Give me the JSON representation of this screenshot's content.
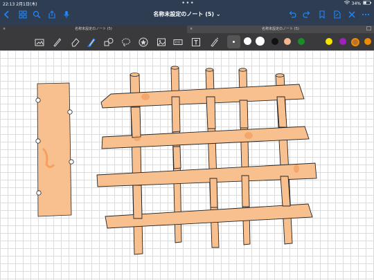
{
  "status": {
    "time": "22:13",
    "date": "2月1日(木)",
    "battery": "34%"
  },
  "header": {
    "title": "名称未設定のノート (5)",
    "title_chevron": "⌄"
  },
  "tabs": [
    {
      "label": "名称未設定のノート (5)",
      "close": "×"
    },
    {
      "label": "名称未設定のノート (5)",
      "close": "×"
    }
  ],
  "colors": {
    "header_bg": "#2e3d52",
    "toolbar_bg": "#3a3a3c",
    "accent": "#1e88ff",
    "sketch_fill": "#f9c08f",
    "sketch_line": "#222222"
  },
  "toolbar": {
    "tools": [
      "image-scan-icon",
      "pen-icon",
      "eraser-icon",
      "highlighter-icon",
      "shapes-icon",
      "lasso-icon",
      "elements-icon",
      "image-icon",
      "camera-icon",
      "text-icon",
      "laser-pointer-icon"
    ],
    "swatches": [
      "#ffffff",
      "#ffffff",
      "#111111",
      "#e53935",
      "#f5b78c",
      "#1a8c2a",
      "#f5e400",
      "#a020c0",
      "#9c27b0",
      "#f08a00",
      "#b8742e"
    ]
  }
}
